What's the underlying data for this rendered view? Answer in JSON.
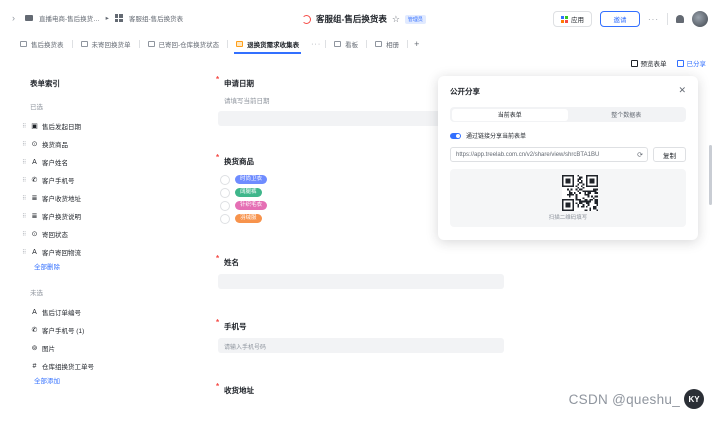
{
  "topbar": {
    "breadcrumb": [
      "直播电商-售后换货…",
      "客服组-售后换货表"
    ],
    "title": "客服组-售后换货表",
    "admin_tag": "管理员",
    "app_label": "应用",
    "invite_label": "邀请"
  },
  "tabs": [
    {
      "label": "售后换货表",
      "active": false
    },
    {
      "label": "未寄回换货单",
      "active": false
    },
    {
      "label": "已寄回-仓库换货状态",
      "active": false
    },
    {
      "label": "退换货需求收集表",
      "active": true
    },
    {
      "label": "看板",
      "active": false
    },
    {
      "label": "相册",
      "active": false
    }
  ],
  "toolbar": {
    "preview_label": "预览表单",
    "share_label": "已分享"
  },
  "index": {
    "title": "表单索引",
    "selected_heading": "已选",
    "selected": [
      {
        "icon": "calendar-icon",
        "glyph": "▣",
        "label": "售后发起日期"
      },
      {
        "icon": "single-select-icon",
        "glyph": "⊙",
        "label": "换货商品"
      },
      {
        "icon": "text-icon",
        "glyph": "A",
        "label": "客户姓名"
      },
      {
        "icon": "phone-icon",
        "glyph": "✆",
        "label": "客户手机号"
      },
      {
        "icon": "multiline-text-icon",
        "glyph": "≣",
        "label": "客户收货地址"
      },
      {
        "icon": "multiline-text-icon",
        "glyph": "≣",
        "label": "客户换货说明"
      },
      {
        "icon": "single-select-icon",
        "glyph": "⊙",
        "label": "寄回状态"
      },
      {
        "icon": "text-icon",
        "glyph": "A",
        "label": "客户寄回物流"
      }
    ],
    "delete_all": "全部删除",
    "unselected_heading": "未选",
    "unselected": [
      {
        "icon": "text-icon",
        "glyph": "A",
        "label": "售后订单编号"
      },
      {
        "icon": "phone-icon",
        "glyph": "✆",
        "label": "客户手机号 (1)"
      },
      {
        "icon": "attachment-icon",
        "glyph": "⊚",
        "label": "图片"
      },
      {
        "icon": "number-icon",
        "glyph": "#",
        "label": "仓库组换货工单号"
      }
    ],
    "add_all": "全部添加"
  },
  "form": {
    "f1": {
      "label": "申请日期",
      "desc": "请填写当前日期"
    },
    "f2": {
      "label": "换货商品",
      "options": [
        {
          "label": "时尚卫衣",
          "color": "#6f8cff"
        },
        {
          "label": "阔腿裤",
          "color": "#3fb68b"
        },
        {
          "label": "针织毛衣",
          "color": "#e56fb4"
        },
        {
          "label": "羽绒服",
          "color": "#f7934c"
        }
      ]
    },
    "f3": {
      "label": "姓名"
    },
    "f4": {
      "label": "手机号",
      "placeholder": "请输入手机号码"
    },
    "f5": {
      "label": "收货地址"
    }
  },
  "share": {
    "title": "公开分享",
    "seg_current": "当前表单",
    "seg_all": "整个数据表",
    "toggle_label": "通过链接分享当前表单",
    "link": "https://app.treelab.com.cn/v2/share/view/shrcBTA1BU",
    "copy_label": "复制",
    "qr_caption": "扫描二维码填写"
  },
  "watermark": "CSDN @queshu_"
}
